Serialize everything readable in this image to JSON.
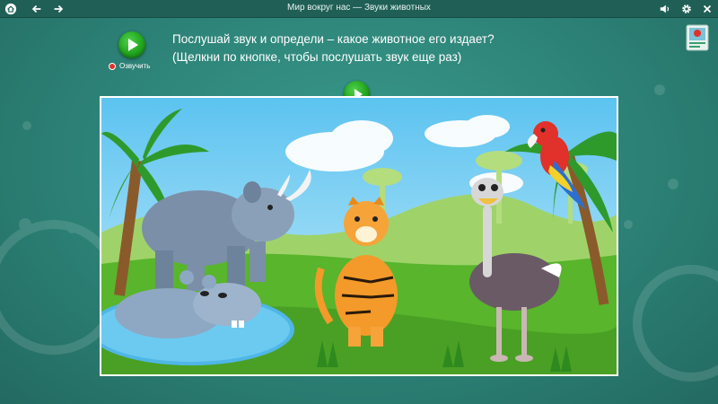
{
  "window": {
    "title": "Мир вокруг нас — Звуки животных",
    "icons": [
      "home-icon",
      "back-arrow-icon",
      "forward-arrow-icon",
      "volume-icon",
      "gear-icon",
      "close-icon"
    ]
  },
  "prompt": {
    "voice_label": "Озвучить",
    "line1": "Послушай звук и определи – какое животное его издает?",
    "line2": "(Щелкни по кнопке, чтобы послушать звук еще раз)"
  },
  "scene": {
    "animals": [
      "rhinoceros",
      "hippopotamus",
      "tiger",
      "ostrich",
      "parrot"
    ]
  },
  "colors": {
    "background": "#2b7f74",
    "topbar": "#1f5f56",
    "play_button": "#21a51e",
    "voice_dot": "#e0312a"
  }
}
